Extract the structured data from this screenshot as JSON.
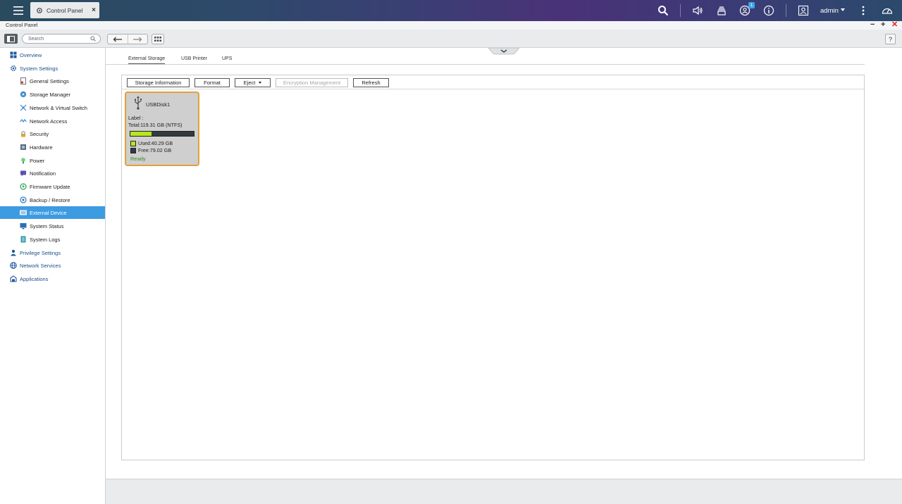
{
  "taskbar": {
    "app_tab_label": "Control Panel",
    "notification_badge": "1",
    "user_name": "admin"
  },
  "window": {
    "title": "Control Panel"
  },
  "toolbar": {
    "search_placeholder": "Search",
    "help_label": "?"
  },
  "sidebar": {
    "items": [
      {
        "label": "Overview",
        "icon": "overview-icon",
        "level": "top"
      },
      {
        "label": "System Settings",
        "icon": "gear-icon",
        "level": "top"
      },
      {
        "label": "General Settings",
        "icon": "general-settings-icon",
        "level": "sub"
      },
      {
        "label": "Storage Manager",
        "icon": "storage-icon",
        "level": "sub"
      },
      {
        "label": "Network & Virtual Switch",
        "icon": "network-switch-icon",
        "level": "sub"
      },
      {
        "label": "Network Access",
        "icon": "network-access-icon",
        "level": "sub"
      },
      {
        "label": "Security",
        "icon": "lock-icon",
        "level": "sub"
      },
      {
        "label": "Hardware",
        "icon": "hardware-icon",
        "level": "sub"
      },
      {
        "label": "Power",
        "icon": "power-icon",
        "level": "sub"
      },
      {
        "label": "Notification",
        "icon": "notification-icon",
        "level": "sub"
      },
      {
        "label": "Firmware Update",
        "icon": "firmware-icon",
        "level": "sub"
      },
      {
        "label": "Backup / Restore",
        "icon": "backup-icon",
        "level": "sub"
      },
      {
        "label": "External Device",
        "icon": "external-device-icon",
        "level": "sub",
        "active": true
      },
      {
        "label": "System Status",
        "icon": "monitor-icon",
        "level": "sub"
      },
      {
        "label": "System Logs",
        "icon": "logs-icon",
        "level": "sub"
      },
      {
        "label": "Privilege Settings",
        "icon": "user-icon",
        "level": "top"
      },
      {
        "label": "Network Services",
        "icon": "globe-icon",
        "level": "top"
      },
      {
        "label": "Applications",
        "icon": "applications-icon",
        "level": "top"
      }
    ]
  },
  "content": {
    "tabs": [
      {
        "label": "External Storage",
        "active": true
      },
      {
        "label": "USB Printer",
        "active": false
      },
      {
        "label": "UPS",
        "active": false
      }
    ],
    "buttons": {
      "storage_information": "Storage Information",
      "format": "Format",
      "eject": "Eject",
      "encryption_management": "Encryption Management",
      "refresh": "Refresh"
    },
    "disk": {
      "name": "USBDisk1",
      "label_text": "Label :",
      "total_text": "Total:119.31 GB (NTFS)",
      "used_text": "Used:40.29 GB",
      "free_text": "Free:79.02 GB",
      "status": "Ready",
      "used_fraction": 0.3377
    }
  },
  "colors": {
    "accent": "#3d9be2",
    "used_color": "#b8e61e",
    "free_color": "#333a3f",
    "card_border": "#e3a038",
    "ready_color": "#3a8a22"
  }
}
